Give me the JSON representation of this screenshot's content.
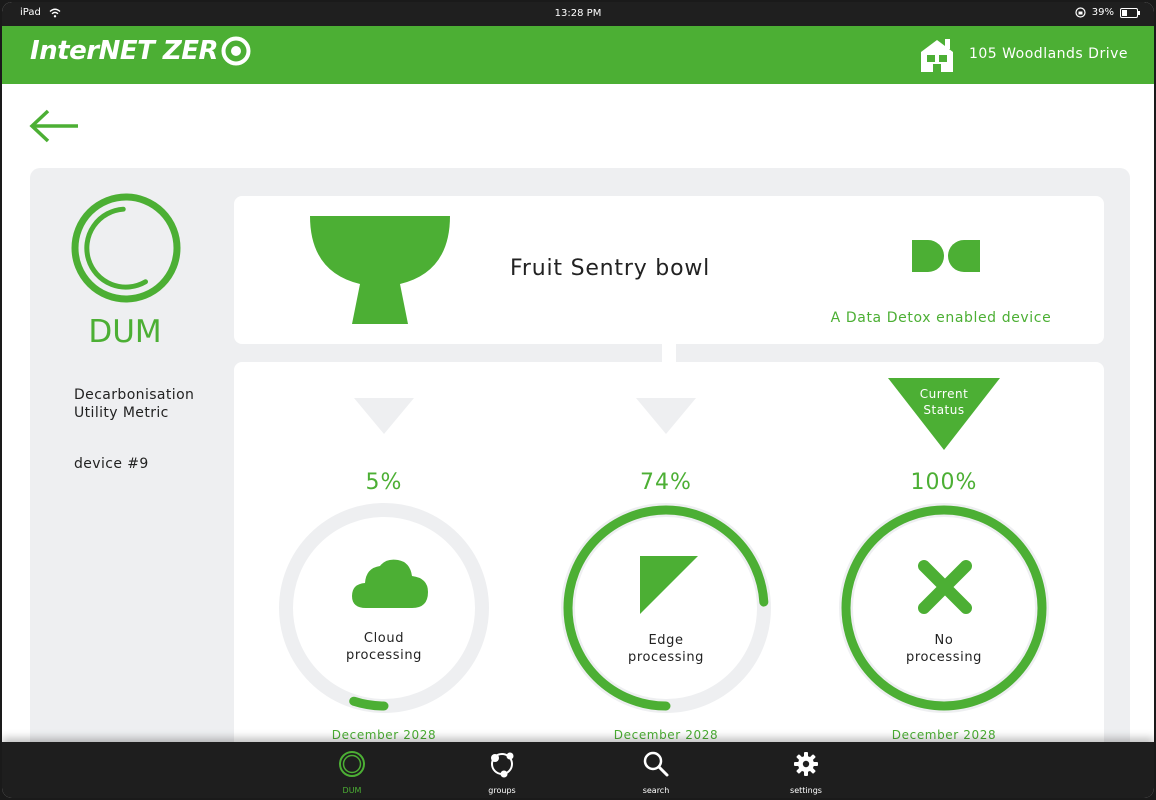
{
  "statusbar": {
    "device": "iPad",
    "time": "13:28 PM",
    "battery": "39%",
    "battery_level": 0.39
  },
  "header": {
    "brand": "InterNET ZER",
    "address": "105 Woodlands Drive"
  },
  "metric": {
    "short": "DUM",
    "description_line1": "Decarbonisation",
    "description_line2": "Utility Metric",
    "device_id": "device #9"
  },
  "device": {
    "name": "Fruit Sentry bowl",
    "badge": "A Data Detox enabled device"
  },
  "stages": [
    {
      "percent": "5%",
      "value": 0.05,
      "label_line1": "Cloud",
      "label_line2": "processing",
      "date": "December 2028",
      "icon": "cloud-icon"
    },
    {
      "percent": "74%",
      "value": 0.74,
      "label_line1": "Edge",
      "label_line2": "processing",
      "date": "December 2028",
      "icon": "edge-triangle-icon"
    },
    {
      "percent": "100%",
      "value": 1.0,
      "label_line1": "No",
      "label_line2": "processing",
      "date": "December 2028",
      "icon": "cross-icon",
      "status_line1": "Current",
      "status_line2": "Status"
    }
  ],
  "tabs": [
    {
      "label": "DUM",
      "icon": "dum-ring-icon",
      "active": true
    },
    {
      "label": "groups",
      "icon": "groups-icon",
      "active": false
    },
    {
      "label": "search",
      "icon": "search-icon",
      "active": false
    },
    {
      "label": "settings",
      "icon": "gear-icon",
      "active": false
    }
  ],
  "colors": {
    "accent": "#4caf34",
    "ring_track": "#eeeff1",
    "panel": "#eeeff1",
    "tabbar": "#1e1e1e"
  }
}
